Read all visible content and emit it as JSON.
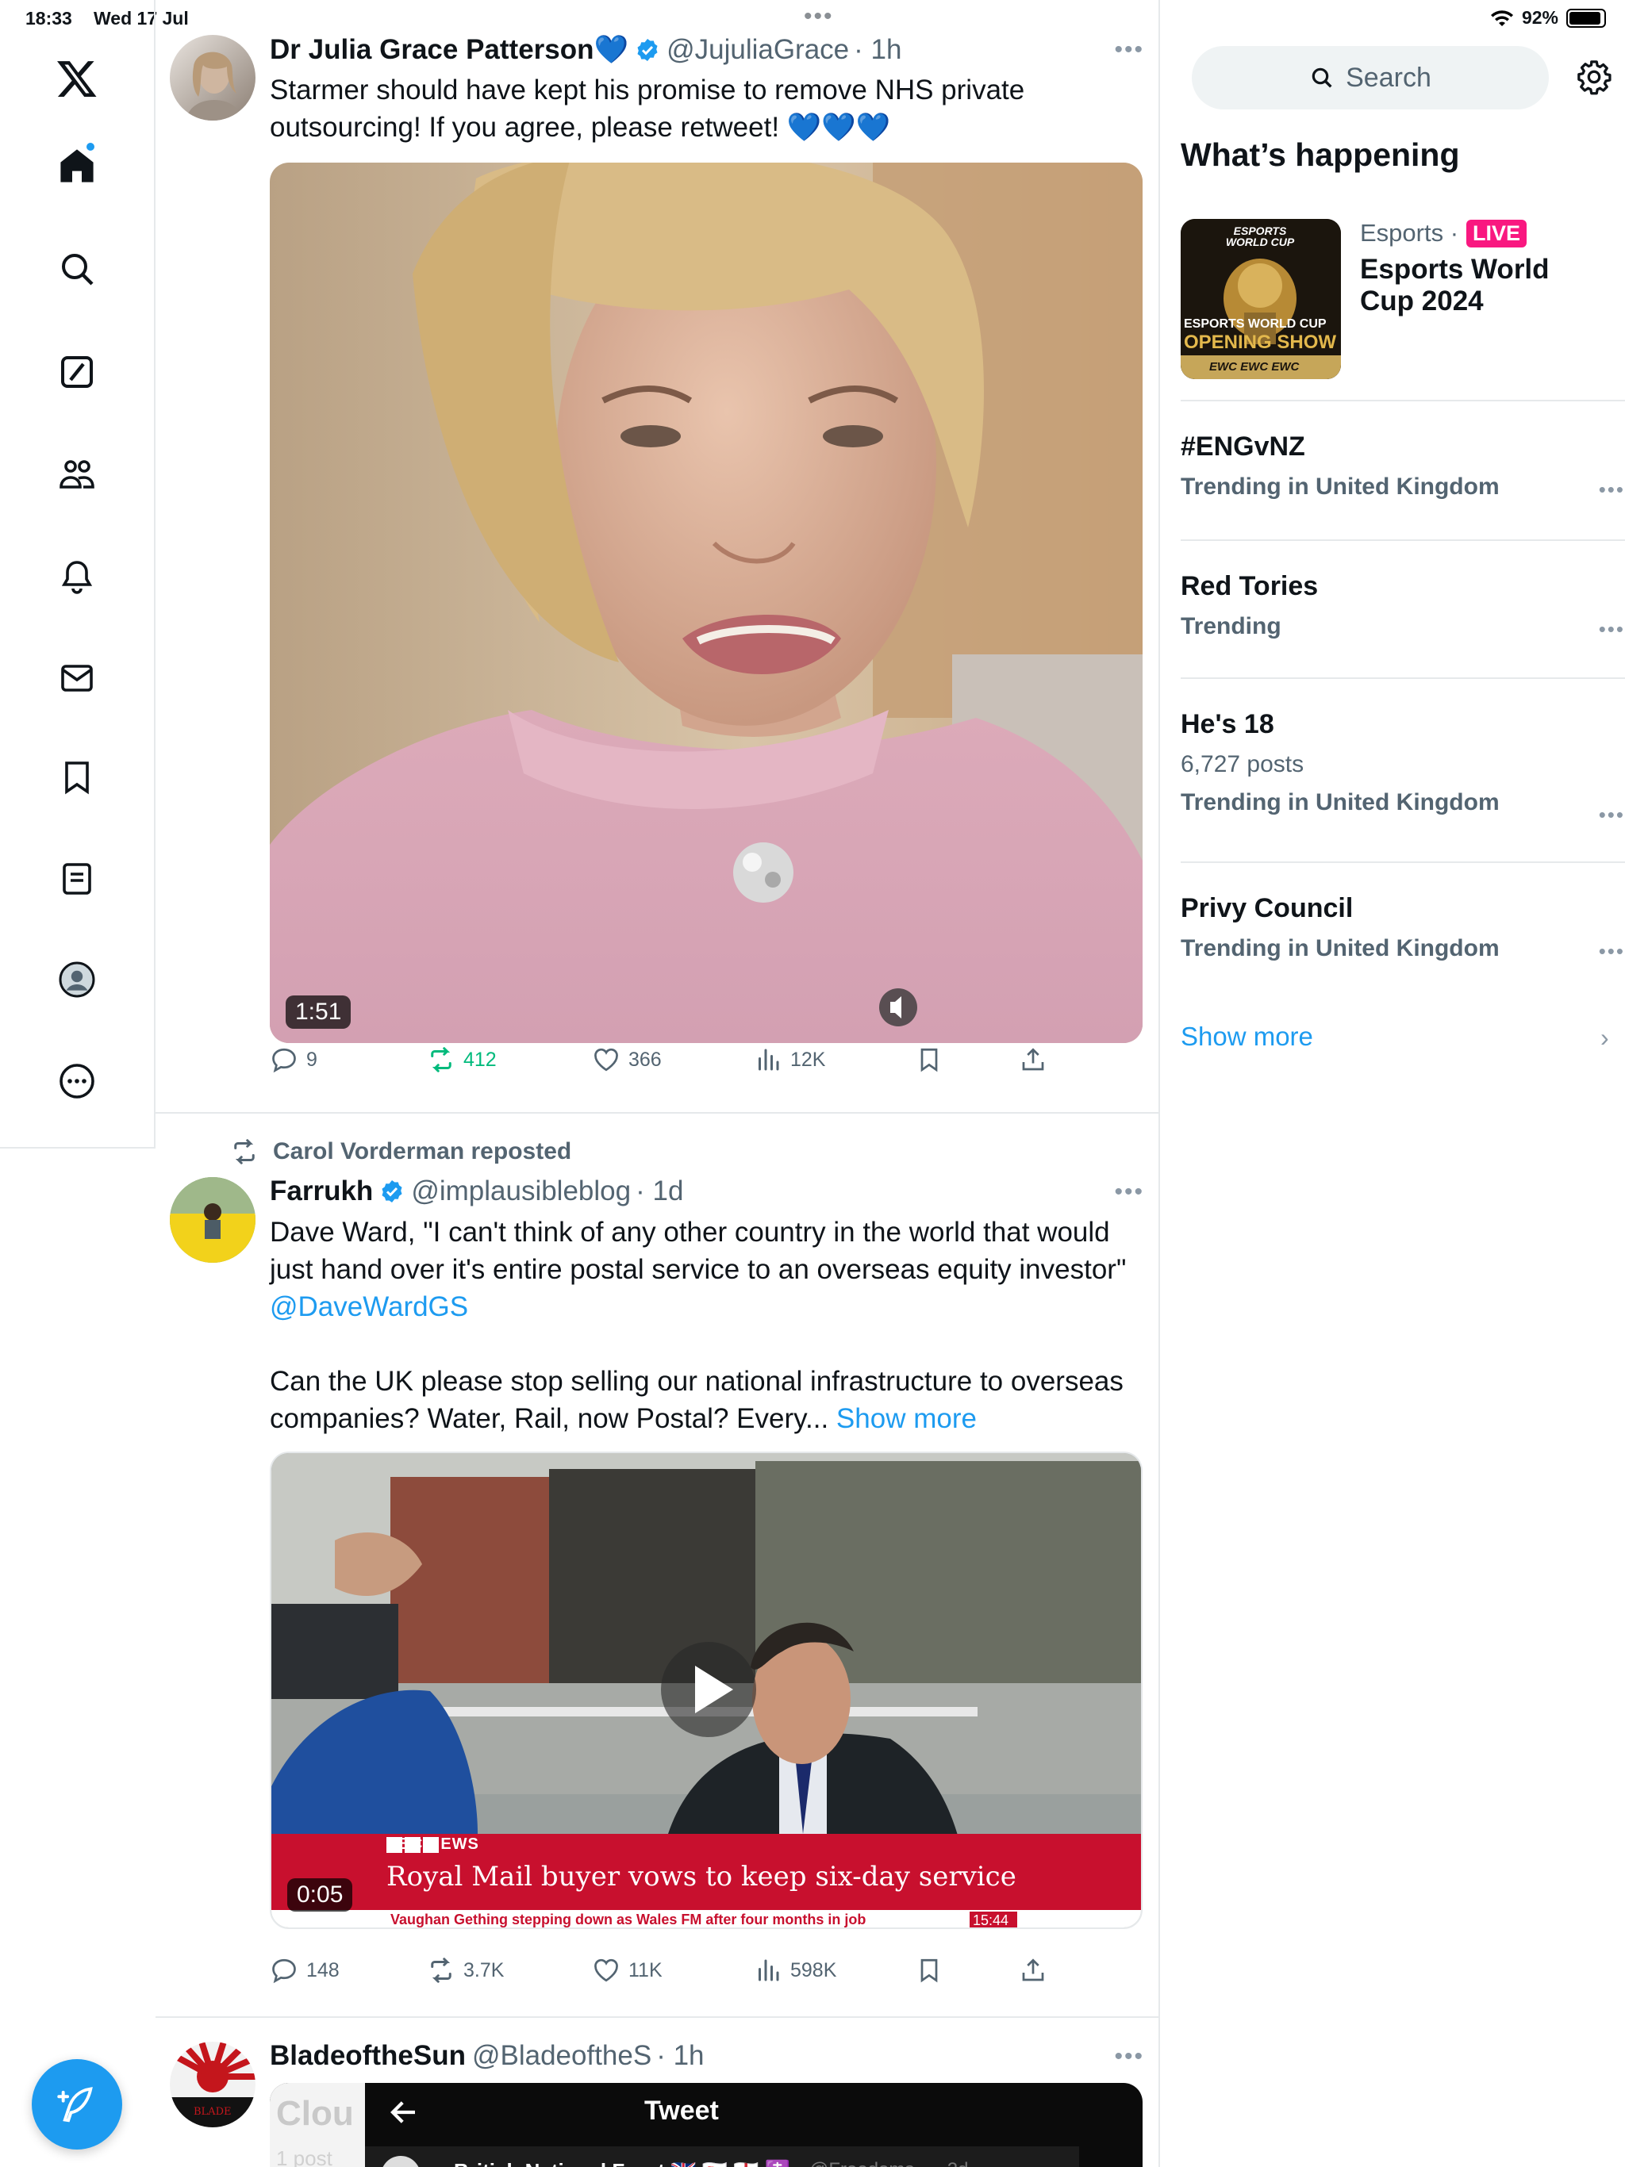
{
  "status": {
    "time": "18:33",
    "date": "Wed 17 Jul",
    "battery": "92%",
    "battery_level": 0.92
  },
  "nav": {
    "items": [
      "X logo",
      "Home",
      "Explore",
      "Grok",
      "Communities",
      "Notifications",
      "Messages",
      "Bookmarks",
      "Lists",
      "Profile",
      "More"
    ]
  },
  "tweets": [
    {
      "name": "Dr Julia Grace Patterson💙",
      "handle": "@JujuliaGrace",
      "time": "· 1h",
      "text": "Starmer should have kept his promise to remove NHS private outsourcing! If you agree, please retweet! 💙💙💙",
      "video_duration": "1:51",
      "replies": "9",
      "reposts": "412",
      "likes": "366",
      "views": "12K"
    },
    {
      "repost_by": "Carol Vorderman reposted",
      "name": "Farrukh",
      "handle": "@implausibleblog",
      "time": "· 1d",
      "text_line1": "Dave Ward, \"I can't think of any other country in the world that would just hand over it's entire postal service to an overseas equity investor\"",
      "mention": "@DaveWardGS",
      "text_line2": "Can the UK please stop selling our national infrastructure to overseas companies? Water, Rail, now Postal? Every...",
      "show_more": "Show more",
      "video_duration": "0:05",
      "news_brand": "BBC NEWS",
      "news_headline": "Royal Mail buyer vows to keep six-day service",
      "news_ticker": "Vaughan Gething stepping down as Wales FM after four months in job",
      "news_clock": "15:44",
      "replies": "148",
      "reposts": "3.7K",
      "likes": "11K",
      "views": "598K"
    },
    {
      "name": "BladeoftheSun",
      "handle": "@BladeoftheS",
      "time": "· 1h",
      "embed_title": "Tweet",
      "embed_name": "British National Front 🇬🇧 🇸🇰 🏴󠁧󠁢󠁥󠁮󠁧󠁿 ☦️",
      "embed_handle": "@Freedoms... · 2d",
      "embed_bg_title": "Clou",
      "embed_bg_posts": "1 post"
    }
  ],
  "right": {
    "search_placeholder": "Search",
    "section_title": "What’s happening",
    "featured": {
      "category": "Esports ·",
      "live": "LIVE",
      "title": "Esports World Cup 2024",
      "image_text_top": "ESPORTS WORLD CUP",
      "image_text_mid": "ESPORTS WORLD CUP",
      "image_text_show": "OPENING SHOW",
      "image_text_bottom": "EWC EWC EWC"
    },
    "trends": [
      {
        "name": "#ENGvNZ",
        "posts": "",
        "meta": "Trending in United Kingdom"
      },
      {
        "name": "Red Tories",
        "posts": "",
        "meta": "Trending"
      },
      {
        "name": "He's 18",
        "posts": "6,727 posts",
        "meta": "Trending in United Kingdom"
      },
      {
        "name": "Privy Council",
        "posts": "",
        "meta": "Trending in United Kingdom"
      }
    ],
    "show_more": "Show more"
  },
  "colors": {
    "accent": "#1d9bf0",
    "repost_active": "#00ba7c",
    "live": "#f91880",
    "bbc_red": "#c8102e"
  }
}
